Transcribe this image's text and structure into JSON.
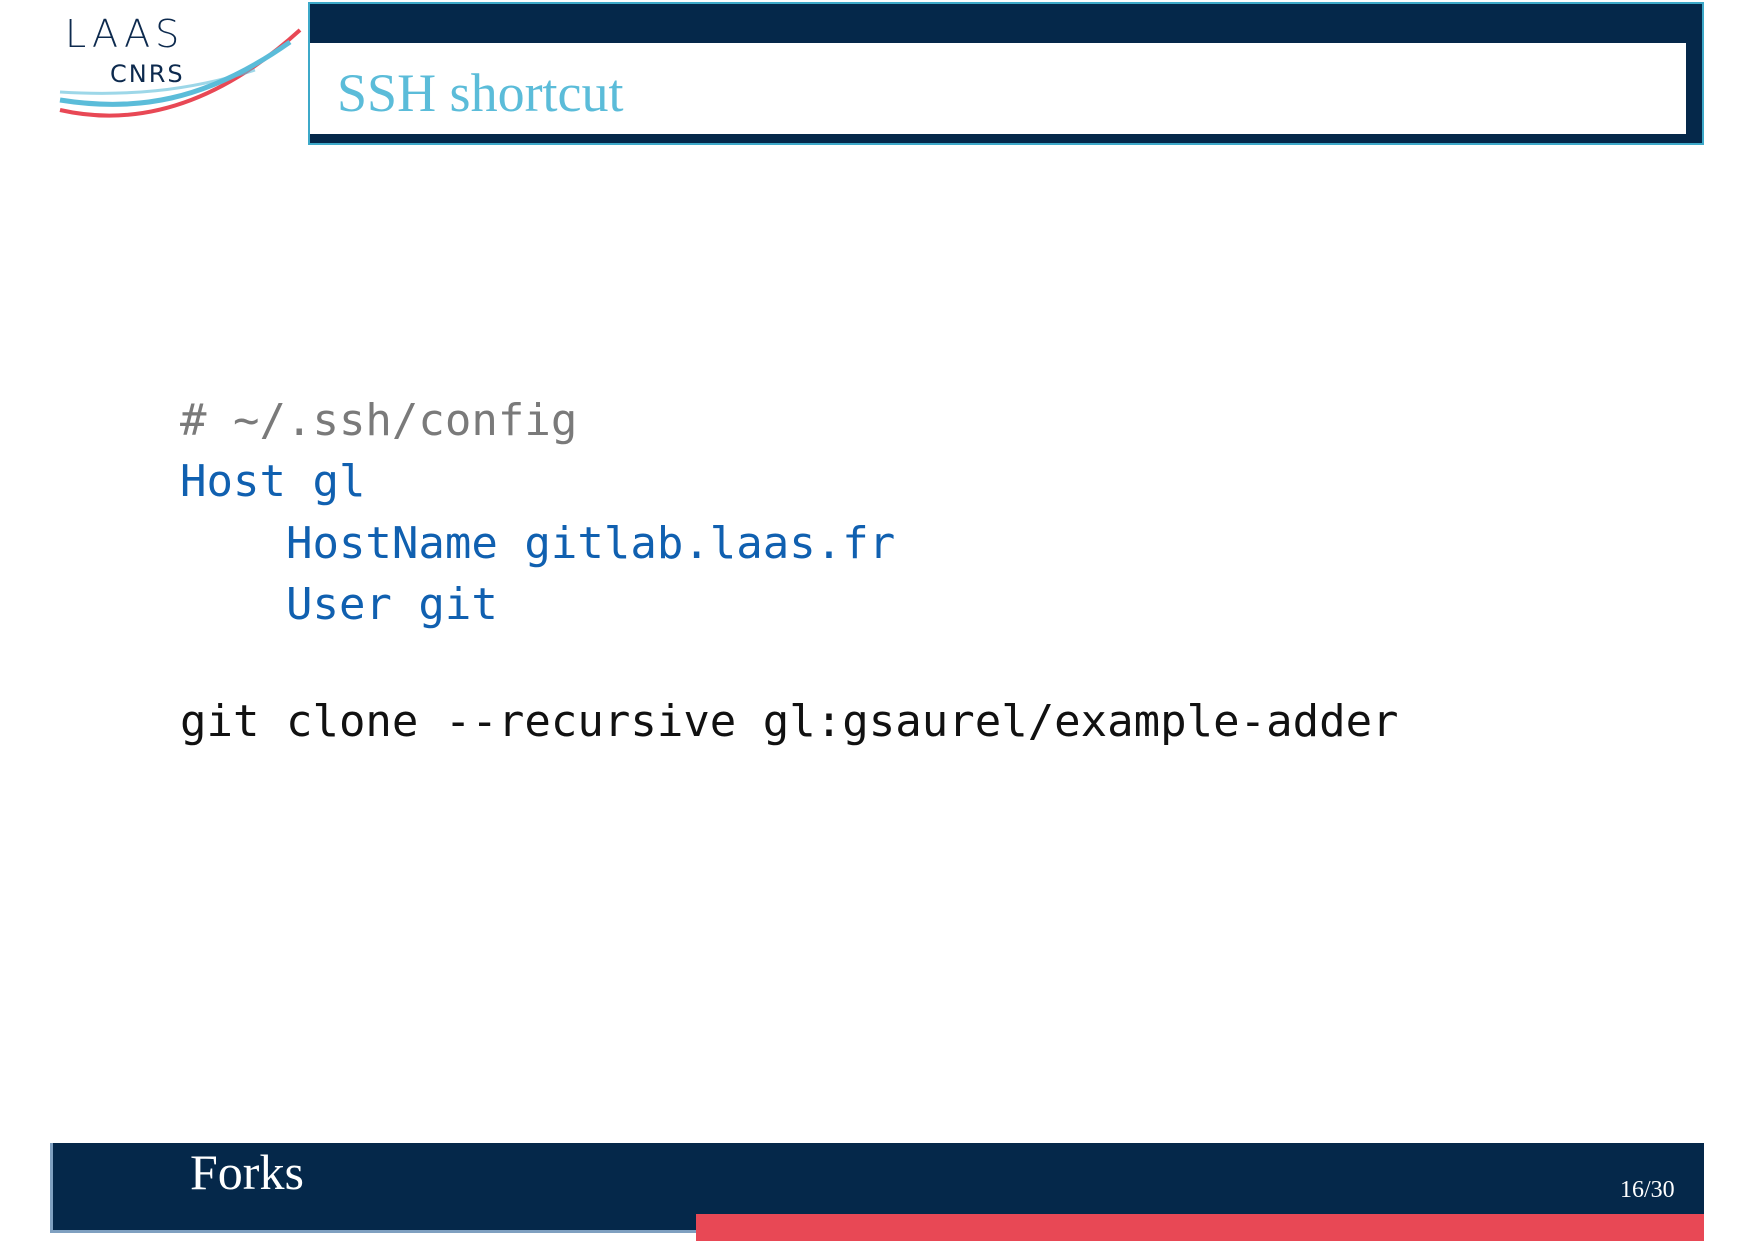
{
  "logo": {
    "line1": "LAAS",
    "line2": "CNRS"
  },
  "slide": {
    "title": "SSH shortcut"
  },
  "code": {
    "comment": "# ~/.ssh/config",
    "host_line": "Host gl",
    "hostname_line": "    HostName gitlab.laas.fr",
    "user_line": "    User git",
    "command_line": "git clone --recursive gl:gsaurel/example-adder"
  },
  "footer": {
    "section": "Forks",
    "page": "16/30"
  },
  "colors": {
    "navy": "#05284a",
    "title_blue": "#5bbcd9",
    "code_blue": "#1060b0",
    "accent_red": "#e84855"
  }
}
